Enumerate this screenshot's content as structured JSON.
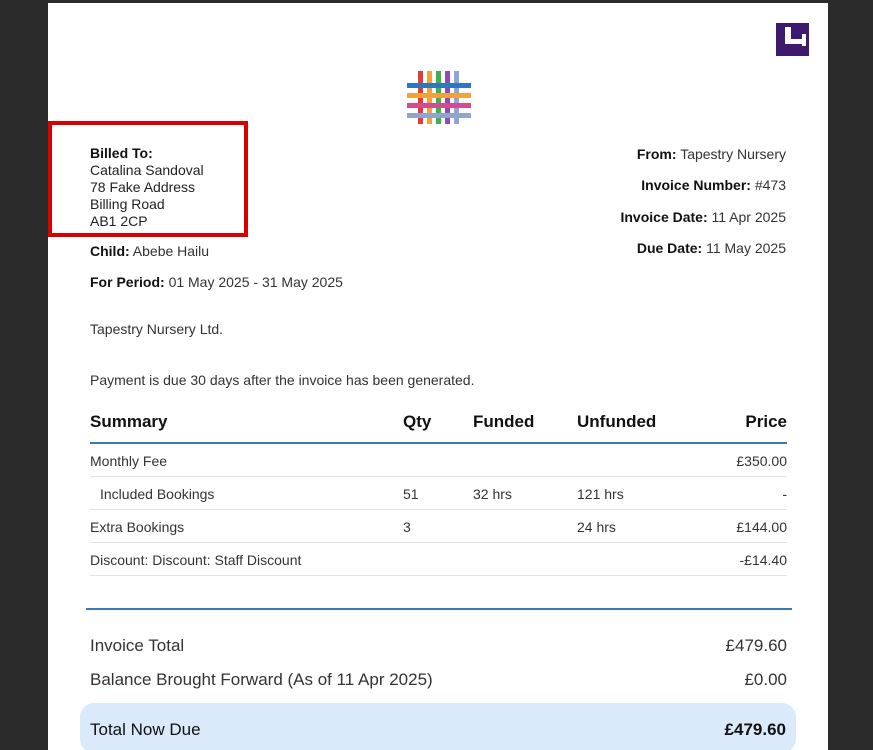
{
  "billed_to": {
    "label": "Billed To:",
    "name": "Catalina Sandoval",
    "address1": "78 Fake Address",
    "address2": "Billing Road",
    "postcode": "AB1 2CP"
  },
  "child": {
    "label": "Child:",
    "value": "Abebe Hailu"
  },
  "period": {
    "label": "For Period:",
    "value": "01 May 2025 - 31 May 2025"
  },
  "from": {
    "label": "From:",
    "value": "Tapestry Nursery"
  },
  "invoice_number": {
    "label": "Invoice Number:",
    "value": "#473"
  },
  "invoice_date": {
    "label": "Invoice Date:",
    "value": "11 Apr 2025"
  },
  "due_date": {
    "label": "Due Date:",
    "value": "11 May 2025"
  },
  "company": "Tapestry Nursery Ltd.",
  "payment_note": "Payment is due 30 days after the invoice has been generated.",
  "table": {
    "headers": {
      "summary": "Summary",
      "qty": "Qty",
      "funded": "Funded",
      "unfunded": "Unfunded",
      "price": "Price"
    },
    "rows": [
      {
        "summary": "Monthly Fee",
        "qty": "",
        "funded": "",
        "unfunded": "",
        "price": "£350.00"
      },
      {
        "summary": "Included Bookings",
        "qty": "51",
        "funded": "32 hrs",
        "unfunded": "121 hrs",
        "price": "-"
      },
      {
        "summary": "Extra Bookings",
        "qty": "3",
        "funded": "",
        "unfunded": "24 hrs",
        "price": "£144.00"
      },
      {
        "summary": "Discount: Discount: Staff Discount",
        "qty": "",
        "funded": "",
        "unfunded": "",
        "price": "-£14.40"
      }
    ]
  },
  "totals": {
    "invoice_total_label": "Invoice Total",
    "invoice_total_value": "£479.60",
    "balance_label": "Balance Brought Forward (As of 11 Apr 2025)",
    "balance_value": "£0.00",
    "due_label": "Total Now Due",
    "due_value": "£479.60"
  },
  "colors": {
    "corner_logo": "#3d1a6e",
    "highlight": "#d90000",
    "rule": "#3a7ab0",
    "due_background": "#dbeafb"
  }
}
